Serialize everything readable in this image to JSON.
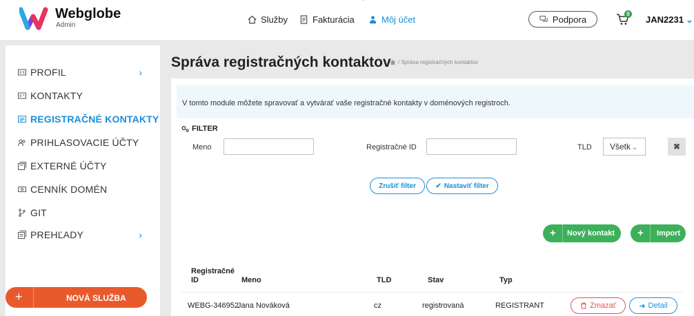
{
  "header": {
    "brand": "Webglobe",
    "brand_sub": "Admin",
    "nav": [
      {
        "label": "Služby",
        "icon": "home-icon"
      },
      {
        "label": "Fakturácia",
        "icon": "invoice-icon"
      },
      {
        "label": "Môj účet",
        "icon": "user-icon",
        "active": true
      }
    ],
    "support_label": "Podpora",
    "cart_count": "0",
    "user_label": "JAN2231"
  },
  "sidebar": {
    "items": [
      {
        "label": "PROFIL",
        "icon": "id-card-icon",
        "has_chevron": true
      },
      {
        "label": "KONTAKTY",
        "icon": "contact-card-icon"
      },
      {
        "label": "REGISTRAČNÉ KONTAKTY",
        "icon": "registry-card-icon",
        "active": true
      },
      {
        "label": "PRIHLASOVACIE ÚČTY",
        "icon": "login-accounts-icon"
      },
      {
        "label": "EXTERNÉ ÚČTY",
        "icon": "external-accounts-icon"
      },
      {
        "label": "CENNÍK DOMÉN",
        "icon": "pricelist-icon"
      },
      {
        "label": "GIT",
        "icon": "git-icon"
      },
      {
        "label": "PREHĽADY",
        "icon": "reports-icon",
        "has_chevron": true
      }
    ],
    "new_service_label": "NOVÁ SLUŽBA"
  },
  "main": {
    "title": "Správa registračných kontaktov",
    "breadcrumb": "/ Správa registračných kontaktov",
    "info_text": "V tomto module môžete spravovať a vytvárať vaše registračné kontakty v doménových registroch.",
    "filter": {
      "heading": "FILTER",
      "name_label": "Meno",
      "name_value": "",
      "regid_label": "Registračné ID",
      "regid_value": "",
      "tld_label": "TLD",
      "tld_selected": "Všetk",
      "cancel_label": "Zrušiť filter",
      "apply_label": "Nastaviť filter"
    },
    "new_contact_label": "Nový kontakt",
    "import_label": "Import",
    "table": {
      "headers": [
        "Registračné ID",
        "Meno",
        "TLD",
        "Stav",
        "Typ"
      ],
      "rows": [
        {
          "id": "WEBG-346952",
          "name": "Jana Nováková",
          "tld": "cz",
          "status": "registrovaná",
          "type": "REGISTRANT",
          "delete_label": "Zmazať",
          "detail_label": "Detail"
        }
      ]
    }
  },
  "colors": {
    "accent": "#1a8fd8",
    "orange": "#e85a2c",
    "green": "#3cb05a",
    "danger": "#e05353"
  }
}
